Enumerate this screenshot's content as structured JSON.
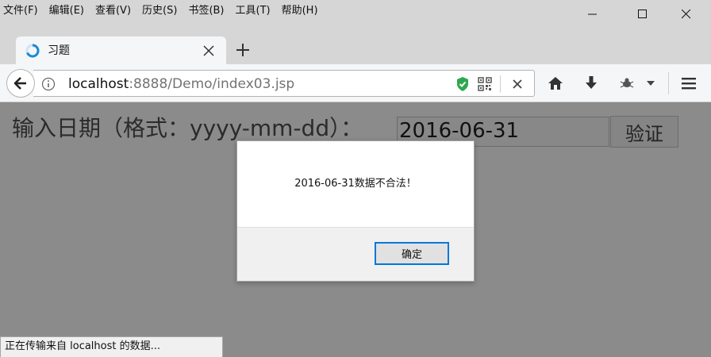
{
  "menu": [
    "文件(F)",
    "编辑(E)",
    "查看(V)",
    "历史(S)",
    "书签(B)",
    "工具(T)",
    "帮助(H)"
  ],
  "tab": {
    "title": "习题"
  },
  "url": {
    "host": "localhost",
    "rest": ":8888/Demo/index03.jsp"
  },
  "form": {
    "label": "输入日期（格式：yyyy-mm-dd）：",
    "date_value": "2016-06-31",
    "verify_label": "验证"
  },
  "dialog": {
    "message": "2016-06-31数据不合法！",
    "ok_label": "确定"
  },
  "status": {
    "text": "正在传输来自 localhost 的数据..."
  },
  "colors": {
    "accent": "#0078d7",
    "overlay": "#8b8b8b",
    "shield": "#2ea84f"
  }
}
